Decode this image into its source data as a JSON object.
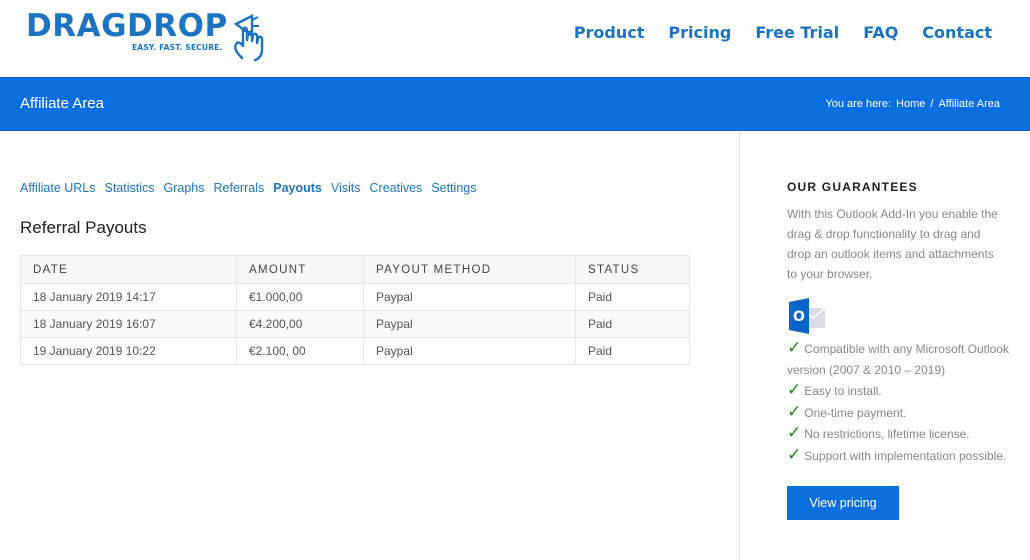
{
  "logo": {
    "name": "DRAGDROP",
    "tagline": "EASY. FAST. SECURE."
  },
  "nav": [
    {
      "label": "Product"
    },
    {
      "label": "Pricing"
    },
    {
      "label": "Free Trial"
    },
    {
      "label": "FAQ"
    },
    {
      "label": "Contact"
    }
  ],
  "titlebar": {
    "title": "Affiliate Area",
    "breadcrumb_prefix": "You are here:",
    "breadcrumb_home": "Home",
    "breadcrumb_sep": "/",
    "breadcrumb_current": "Affiliate Area"
  },
  "tabs": [
    {
      "label": "Affiliate URLs"
    },
    {
      "label": "Statistics"
    },
    {
      "label": "Graphs"
    },
    {
      "label": "Referrals"
    },
    {
      "label": "Payouts"
    },
    {
      "label": "Visits"
    },
    {
      "label": "Creatives"
    },
    {
      "label": "Settings"
    }
  ],
  "section_title": "Referral Payouts",
  "table": {
    "headers": [
      "DATE",
      "AMOUNT",
      "PAYOUT METHOD",
      "STATUS"
    ],
    "rows": [
      [
        "18 January 2019 14:17",
        "€1.000,00",
        "Paypal",
        "Paid"
      ],
      [
        "18 January 2019 16:07",
        "€4.200,00",
        "Paypal",
        "Paid"
      ],
      [
        "19 January 2019 10:22",
        "€2.100, 00",
        "Paypal",
        "Paid"
      ]
    ]
  },
  "sidebar": {
    "title": "OUR GUARANTEES",
    "text": "With this Outlook Add-In you enable the drag & drop functionality to drag and drop an outlook items and attachments to your browser.",
    "outlook_icon": "outlook-icon",
    "outlook_letter": "O",
    "checks": [
      "Compatible with any Microsoft Outlook version (2007 & 2010 – 2019)",
      "Easy to install.",
      "One-time payment.",
      "No restrictions, lifetime license.",
      "Support with implementation possible."
    ],
    "button_label": "View pricing"
  },
  "colors": {
    "brand_blue": "#1e73be",
    "bar_blue": "#0c6fde",
    "check_green": "#1f8a1f"
  }
}
